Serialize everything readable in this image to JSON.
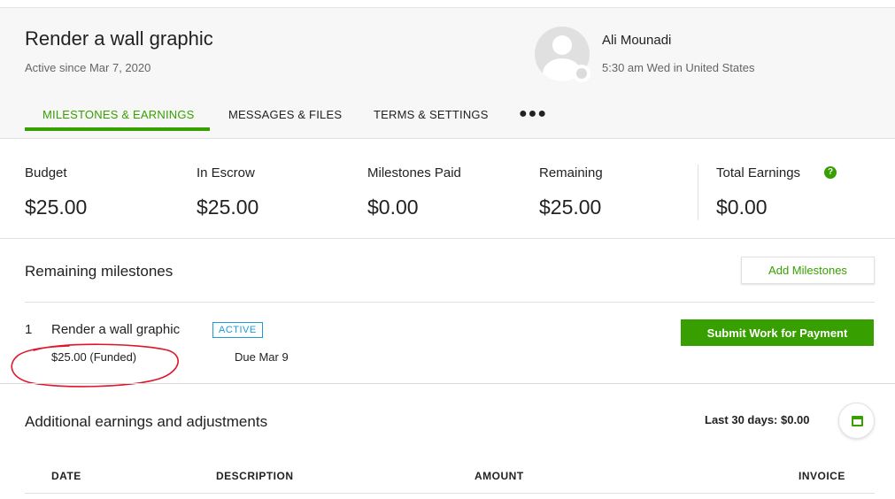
{
  "header": {
    "title": "Render a wall graphic",
    "since": "Active since Mar 7, 2020"
  },
  "client": {
    "name": "Ali Mounadi",
    "local_time": "5:30 am Wed in United States"
  },
  "tabs": [
    {
      "label": "MILESTONES & EARNINGS",
      "active": true
    },
    {
      "label": "MESSAGES & FILES",
      "active": false
    },
    {
      "label": "TERMS & SETTINGS",
      "active": false
    }
  ],
  "more_label": "●●●",
  "stats": [
    {
      "label": "Budget",
      "value": "$25.00"
    },
    {
      "label": "In Escrow",
      "value": "$25.00"
    },
    {
      "label": "Milestones Paid",
      "value": "$0.00"
    },
    {
      "label": "Remaining",
      "value": "$25.00"
    },
    {
      "label": "Total Earnings",
      "value": "$0.00"
    }
  ],
  "help_icon_glyph": "?",
  "remaining": {
    "title": "Remaining milestones",
    "add_button": "Add Milestones"
  },
  "milestone": {
    "number": "1",
    "title": "Render a wall graphic",
    "status": "ACTIVE",
    "amount": "$25.00 (Funded)",
    "due": "Due Mar 9",
    "submit_button": "Submit Work for Payment"
  },
  "additional": {
    "title": "Additional earnings and adjustments",
    "last30": "Last 30 days: $0.00"
  },
  "table_columns": [
    "DATE",
    "DESCRIPTION",
    "AMOUNT",
    "INVOICE"
  ],
  "colors": {
    "accent_green": "#37a000",
    "badge_blue": "#1d9bd6",
    "annotation_red": "#e0142a"
  },
  "icons": [
    "avatar-placeholder-icon",
    "more-dots-icon",
    "help-icon",
    "calendar-icon"
  ]
}
